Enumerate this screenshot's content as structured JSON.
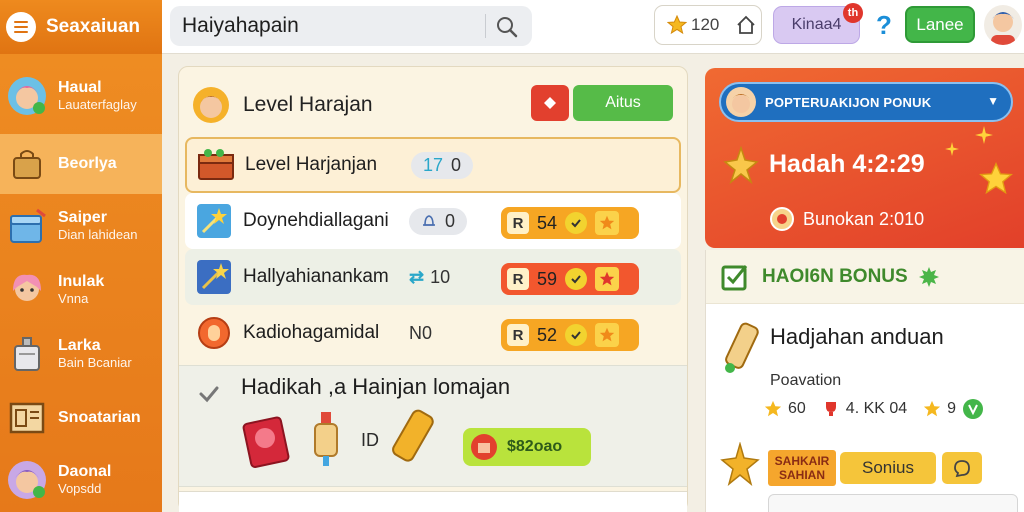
{
  "app": {
    "title": "Seaxaiuan"
  },
  "search": {
    "value": "Haiyahapain"
  },
  "header": {
    "coins": "120",
    "kinga_label": "Kinaa4",
    "kinga_badge": "th",
    "help": "?",
    "lance_label": "Lanee"
  },
  "sidebar": {
    "items": [
      {
        "label": "Haual",
        "sub": "Lauaterfaglay"
      },
      {
        "label": "Beorlya",
        "sub": ""
      },
      {
        "label": "Saiper",
        "sub": "Dian lahidean"
      },
      {
        "label": "Inulak",
        "sub": "Vnna"
      },
      {
        "label": "Larka",
        "sub": "Bain Bcaniar"
      },
      {
        "label": "Snoatarian",
        "sub": ""
      },
      {
        "label": "Daonal",
        "sub": "Vopsdd"
      }
    ]
  },
  "panel": {
    "title": "Level Harajan",
    "action_label": "Aitus",
    "rows": [
      {
        "label": "Level Harjanjan",
        "num_a": "17",
        "num_b": "0",
        "score": ""
      },
      {
        "label": "Doynehdiallagani",
        "num_a": "",
        "num_b": "0",
        "score_r": "R",
        "score": "54"
      },
      {
        "label": "Hallyahianankam",
        "num_a": "",
        "num_b": "10",
        "score_r": "R",
        "score": "59"
      },
      {
        "label": "Kadiohagamidal",
        "num_a": "",
        "num_b": "N0",
        "score_r": "R",
        "score": "52"
      }
    ],
    "bonus": {
      "title": "Hadikah ,a Hainjan lomajan",
      "id_text": "ID",
      "claim_label": "$82oao"
    }
  },
  "right_top": {
    "promo_label": "POPTERUAKIJON PONUK",
    "timer": "Hadah 4:2:29",
    "sub": "Bunokan 2:010"
  },
  "right_bottom": {
    "header": "HAOI6N BONUS",
    "title": "Hadjahan anduan",
    "sub": "Poavation",
    "stats": [
      "60",
      "4. KK 04",
      "9"
    ],
    "tag_line1": "SAHKAIR",
    "tag_line2": "SAHIAN",
    "button": "Sonius"
  },
  "colors": {
    "brand_orange": "#e87f1a",
    "accent_green": "#56bb48",
    "promo_red": "#e2402a",
    "score_orange": "#f6a623"
  }
}
